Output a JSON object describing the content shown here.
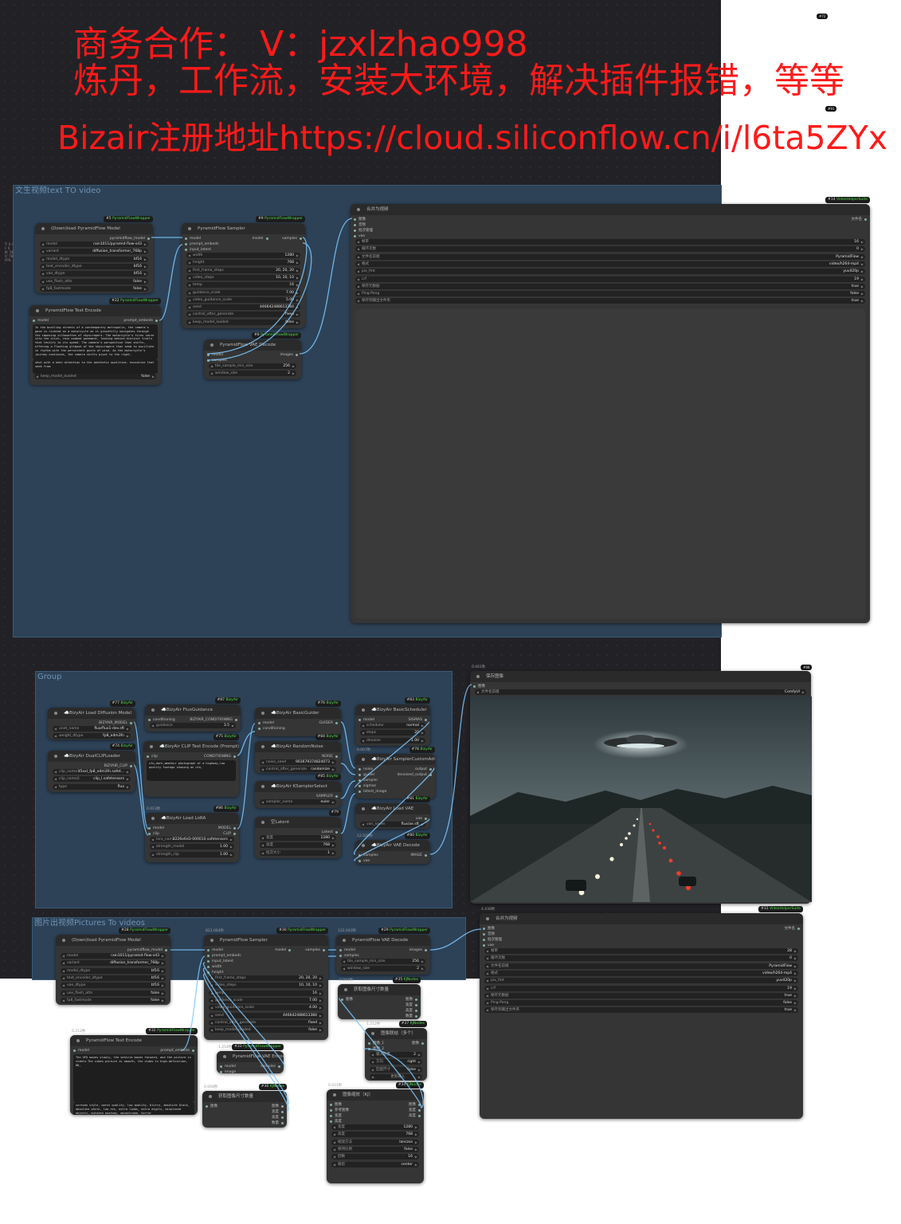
{
  "banner": {
    "line1": "商务合作： V：jzxlzhao998",
    "line2": "炼丹，工作流，安装大环境，解决插件报错，等等",
    "line3": "Bizair注册地址https://cloud.siliconflow.cn/i/l6ta5ZYx"
  },
  "corner_tags": {
    "t72": "#72",
    "t91": "#91",
    "t88": "#88"
  },
  "side_stats": {
    "l1": "T: 0.40s",
    "l2": "I: 0",
    "l3": "N: 54 [54]",
    "l4": "V: 78",
    "l5": "FPS: 60.26"
  },
  "groups": {
    "g1": "文生视频text TO video",
    "g2": "Group",
    "g3": "图片出视频Pictures To videos"
  },
  "nodes": {
    "n5": {
      "badge_id": "#5",
      "badge_pack": "PyramidFlowWrapper",
      "title": "(Down)load PyramidFlow Model",
      "output": "pyramidflow_model",
      "widgets": [
        [
          "model",
          "rain1011/pyramid-flow-sd3"
        ],
        [
          "variant",
          "diffusion_transformer_768p"
        ],
        [
          "model_dtype",
          "bf16"
        ],
        [
          "text_encoder_dtype",
          "bf16"
        ],
        [
          "vae_dtype",
          "bf16"
        ],
        [
          "use_flash_attn",
          "false"
        ],
        [
          "fp8_fastmode",
          "false"
        ]
      ]
    },
    "n22": {
      "badge_id": "#22",
      "badge_pack": "PyramidFlowWrapper",
      "title": "PyramidFlow Text Encode",
      "input": "model",
      "output": "prompt_embeds",
      "text": "In the bustling streets of a contemporary metropolis, the camera's gaze is riveted on a motorcycle as it gracefully navigates through the imposing silhouettes of skyscrapers. The motorcycle's tires carve into the slick, rain-soaked pavement, leaving behind distinct trails that testify to its speed. The camera's perspective then shifts, offering a floating glimpse of the skyscrapers that seem to oscillate in rhythm with the persistent gusts of wind. As the motorcycle's journey continues, the camera shifts pivot to the right,",
      "text2": "shot with a keen attention to the aesthetic qualities. evocative that seek from",
      "widgets": [
        [
          "keep_model_loaded",
          "false"
        ]
      ]
    },
    "n9": {
      "badge_id": "#9",
      "badge_pack": "PyramidFlowWrapper",
      "title": "PyramidFlow Sampler",
      "inputs": [
        "model",
        "prompt_embeds",
        "input_latent"
      ],
      "output_l": "model",
      "output_r": "samples",
      "widgets": [
        [
          "width",
          "1280"
        ],
        [
          "height",
          "768"
        ],
        [
          "first_frame_steps",
          "20, 20, 20"
        ],
        [
          "video_steps",
          "10, 10, 10"
        ],
        [
          "temp",
          "16"
        ],
        [
          "guidance_scale",
          "7.00"
        ],
        [
          "video_guidance_scale",
          "5.00"
        ],
        [
          "seed",
          "446642488613384"
        ],
        [
          "control_after_generate",
          "fixed"
        ],
        [
          "keep_model_loaded",
          "false"
        ]
      ]
    },
    "n8": {
      "badge_id": "#8",
      "badge_pack": "PyramidFlowWrapper",
      "title": "PyramidFlow VAE Decode",
      "inputs": [
        "model",
        "samples"
      ],
      "output": "images",
      "widgets": [
        [
          "tile_sample_min_size",
          "256"
        ],
        [
          "window_size",
          "2"
        ]
      ]
    },
    "n14": {
      "badge_id": "#14",
      "badge_pack": "VideoHelperSuite",
      "title": "合并为视频",
      "inputs": [
        "图像",
        "音频",
        "批次管理",
        "vae"
      ],
      "output": "文件名",
      "widgets": [
        [
          "帧率",
          "16"
        ],
        [
          "循环次数",
          "0"
        ],
        [
          "文件名前缀",
          "PyramidFlow"
        ],
        [
          "格式",
          "video/h264-mp4"
        ],
        [
          "pix_fmt",
          "yuv420p"
        ],
        [
          "crf",
          "19"
        ],
        [
          "保存元数据",
          "true"
        ],
        [
          "Ping-Pong",
          "false"
        ],
        [
          "保存到输出文件夹",
          "true"
        ]
      ]
    },
    "n77": {
      "badge_id": "#77",
      "badge_pack": "BizyAir",
      "title": "☁️BizyAir Load Diffusion Model",
      "output": "BIZYAIR_MODEL",
      "widgets": [
        [
          "unet_name",
          "flux/flux1-dev.sft"
        ],
        [
          "weight_dtype",
          "fp8_e4m3fn"
        ]
      ]
    },
    "n74": {
      "badge_id": "#74",
      "badge_pack": "BizyAir",
      "title": "☁️BizyAir DualCLIPLoader",
      "output": "BIZYAIR_CLIP",
      "widgets": [
        [
          "clip_name1",
          "t5xxl_fp8_e4m3fn.safet..."
        ],
        [
          "clip_name2",
          "clip_l.safetensors"
        ],
        [
          "type",
          "flux"
        ]
      ]
    },
    "n87": {
      "badge_id": "#87",
      "badge_pack": "BizyAir",
      "title": "☁️BizyAir FluxGuidance",
      "input": "conditioning",
      "output": "BIZYAIR_CONDITIONING",
      "widgets": [
        [
          "guidance",
          "3.5"
        ]
      ]
    },
    "n75": {
      "badge_id": "#75",
      "badge_pack": "BizyAir",
      "title": "☁️BizyAir CLIP Text Encode (Prompt)",
      "input": "clip",
      "output": "CONDITIONING",
      "text": "ufo,dark,amateur photograph of a highway,low quality footage showing an ufo,"
    },
    "n86": {
      "timing": "0.013秒",
      "badge_id": "#86",
      "badge_pack": "BizyAir",
      "title": "☁️BizyAir Load LoRA",
      "inputs": [
        "model",
        "clip"
      ],
      "outputs": [
        "MODEL",
        "CLIP"
      ],
      "widgets": [
        [
          "lora_name",
          "2226e6d3-000010.safetensors"
        ],
        [
          "strength_model",
          "1.00"
        ],
        [
          "strength_clip",
          "1.00"
        ]
      ]
    },
    "n76": {
      "badge_id": "#76",
      "badge_pack": "BizyAir",
      "title": "☁️BizyAir BasicGuider",
      "inputs": [
        "model",
        "conditioning"
      ],
      "output": "GUIDER"
    },
    "n84": {
      "badge_id": "#84",
      "badge_pack": "BizyAir",
      "title": "☁️BizyAir RandomNoise",
      "output": "NOISE",
      "widgets": [
        [
          "noise_seed",
          "903679374824073"
        ],
        [
          "control_after_generate",
          "randomize"
        ]
      ]
    },
    "n85": {
      "badge_id": "#85",
      "badge_pack": "BizyAir",
      "title": "☁️BizyAir KSamplerSelect",
      "output": "SAMPLER",
      "widgets": [
        [
          "sampler_name",
          "euler"
        ]
      ]
    },
    "n79": {
      "badge_id": "#79",
      "title": "空Latent",
      "output": "Latent",
      "widgets": [
        [
          "宽度",
          "1280"
        ],
        [
          "高度",
          "768"
        ],
        [
          "批次大小",
          "1"
        ]
      ]
    },
    "n83": {
      "badge_id": "#83",
      "badge_pack": "BizyAir",
      "title": "☁️BizyAir BasicScheduler",
      "input": "model",
      "output": "SIGMAS",
      "widgets": [
        [
          "scheduler",
          "normal"
        ],
        [
          "steps",
          "20"
        ],
        [
          "denoise",
          "1.00"
        ]
      ]
    },
    "n78": {
      "timing": "0.007秒",
      "badge_id": "#78",
      "badge_pack": "BizyAir",
      "title": "☁️BizyAir SamplerCustomAdvanced",
      "inputs": [
        "noise",
        "guider",
        "sampler",
        "sigmas",
        "latent_image"
      ],
      "outputs": [
        "output",
        "denoised_output"
      ]
    },
    "n81": {
      "badge_id": "#81",
      "badge_pack": "BizyAir",
      "title": "☁️BizyAir Load VAE",
      "output": "vae",
      "widgets": [
        [
          "vae_name",
          "flux/ae.sft"
        ]
      ]
    },
    "n80": {
      "timing": "12.020秒",
      "badge_id": "#80",
      "badge_pack": "BizyAir",
      "title": "☁️BizyAir VAE Decode",
      "inputs": [
        "samples",
        "vae"
      ],
      "output": "IMAGE"
    },
    "n88": {
      "timing": "0.061秒",
      "title": "保存图像",
      "input": "图像",
      "widgets": [
        [
          "文件名前缀",
          "ComfyUI"
        ]
      ]
    },
    "n28": {
      "badge_id": "#28",
      "badge_pack": "PyramidFlowWrapper",
      "title": "(Down)load PyramidFlow Model",
      "output": "pyramidflow_model",
      "widgets": [
        [
          "model",
          "rain1011/pyramid-flow-sd3"
        ],
        [
          "variant",
          "diffusion_transformer_768p"
        ],
        [
          "model_dtype",
          "bf16"
        ],
        [
          "text_encoder_dtype",
          "bf16"
        ],
        [
          "vae_dtype",
          "bf16"
        ],
        [
          "use_flash_attn",
          "false"
        ],
        [
          "fp8_fastmode",
          "false"
        ]
      ]
    },
    "n30": {
      "timing": "823.064秒",
      "badge_id": "#30",
      "badge_pack": "PyramidFlowWrapper",
      "title": "PyramidFlow Sampler",
      "inputs": [
        "model",
        "prompt_embeds",
        "input_latent",
        "width",
        "height"
      ],
      "output_l": "model",
      "output_r": "samples",
      "widgets": [
        [
          "first_frame_steps",
          "20, 20, 20"
        ],
        [
          "video_steps",
          "10, 10, 10"
        ],
        [
          "temp",
          "16"
        ],
        [
          "guidance_scale",
          "7.00"
        ],
        [
          "video_guidance_scale",
          "4.00"
        ],
        [
          "seed",
          "446642488613384"
        ],
        [
          "control_after_generate",
          "fixed"
        ],
        [
          "keep_model_loaded",
          "false"
        ]
      ]
    },
    "n29": {
      "timing": "122.043秒",
      "badge_id": "#29",
      "badge_pack": "PyramidFlowWrapper",
      "title": "PyramidFlow VAE Decode",
      "inputs": [
        "model",
        "samples"
      ],
      "output": "images",
      "widgets": [
        [
          "tile_sample_min_size",
          "256"
        ],
        [
          "window_size",
          "2"
        ]
      ]
    },
    "n35": {
      "timing": "0.004秒",
      "badge_id": "#35",
      "badge_pack": "KJNodes",
      "title": "获取图像尺寸数量",
      "input": "图像",
      "outputs": [
        "图像",
        "宽度",
        "高度",
        "数量"
      ]
    },
    "n37": {
      "timing": "1.212秒",
      "badge_id": "#37",
      "badge_pack": "KJNodes",
      "title": "图像联结（多个）",
      "inputs": [
        "图像_1",
        "图像_2"
      ],
      "output": "图像",
      "widgets": [
        [
          "输入数量",
          "2"
        ],
        [
          "方向",
          "right"
        ],
        [
          "匹配尺寸",
          "false"
        ]
      ],
      "button": "更新输入"
    },
    "n31": {
      "timing": "4.438秒",
      "badge_id": "#31",
      "badge_pack": "VideoHelperSuite",
      "title": "合并为视频",
      "inputs": [
        "图像",
        "音频",
        "批次管理",
        "vae"
      ],
      "output": "文件名",
      "widgets": [
        [
          "帧率",
          "28"
        ],
        [
          "循环次数",
          "0"
        ],
        [
          "文件名前缀",
          "PyramidFlow"
        ],
        [
          "格式",
          "video/h264-mp4"
        ],
        [
          "pix_fmt",
          "yuv420p"
        ],
        [
          "crf",
          "19"
        ],
        [
          "保存元数据",
          "true"
        ],
        [
          "Ping-Pong",
          "false"
        ],
        [
          "保存到输出文件夹",
          "true"
        ]
      ]
    },
    "n32": {
      "timing": "0.212秒",
      "badge_id": "#32",
      "badge_pack": "PyramidFlowWrapper",
      "title": "PyramidFlow Text Encode",
      "input": "model",
      "output": "prompt_embeds",
      "text": "The UFO moves slowly, the vehicle moves forward, and the picture is stable.The video picture is smooth, the video is high-definition, HD,",
      "text2": "cartoon style, worst quality, low quality, blurry, absolute black, absolute white, low res, extra limbs, extra digits, misplaced objects, mutated anatomy, monochrome, horror",
      "widgets": [
        [
          "keep_model_loaded",
          "false"
        ]
      ]
    },
    "n33": {
      "timing": "1.254秒",
      "badge_id": "#33",
      "badge_pack": "PyramidFlowWrapper",
      "title": "PyramidFlow VAE Encode",
      "inputs": [
        "model",
        "image"
      ],
      "output": "samples"
    },
    "n36": {
      "timing": "0.008秒",
      "badge_id": "#36",
      "badge_pack": "KJNodes",
      "title": "获取图像尺寸数量",
      "input": "图像",
      "outputs": [
        "图像",
        "宽度",
        "高度",
        "数量"
      ]
    },
    "n34": {
      "timing": "0.021秒",
      "badge_id": "#34",
      "badge_pack": "KJNodes",
      "title": "图像缩放（KJ）",
      "inputs": [
        "图像",
        "参考图像",
        "宽度",
        "高度"
      ],
      "outputs": [
        "图像",
        "宽度",
        "高度"
      ],
      "widgets": [
        [
          "宽度",
          "1280"
        ],
        [
          "高度",
          "768"
        ],
        [
          "缩放方法",
          "lanczos"
        ],
        [
          "保持比例",
          "false"
        ],
        [
          "因数",
          "16"
        ],
        [
          "裁剪",
          "center"
        ]
      ]
    }
  }
}
